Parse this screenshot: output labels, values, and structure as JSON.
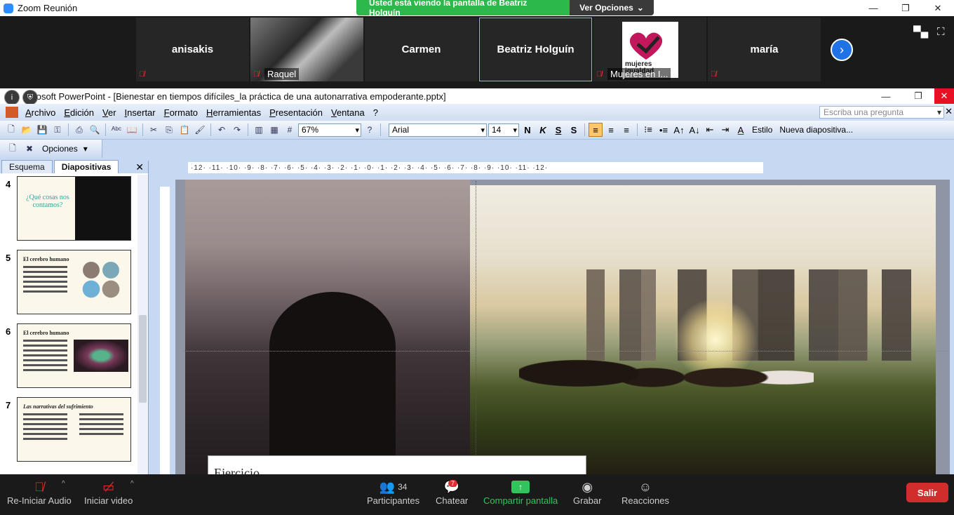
{
  "zoom": {
    "title": "Zoom Reunión",
    "share_banner": "Usted está viendo la pantalla de Beatriz Holguín",
    "view_options": "Ver Opciones",
    "participants": [
      {
        "name": "anisakis",
        "muted": true,
        "label": ""
      },
      {
        "name": "",
        "muted": true,
        "label": "Raquel"
      },
      {
        "name": "Carmen",
        "muted": false,
        "label": ""
      },
      {
        "name": "Beatriz Holguín",
        "muted": false,
        "label": ""
      },
      {
        "name": "",
        "muted": true,
        "label": "Mujeres en I..."
      },
      {
        "name": "maría",
        "muted": true,
        "label": ""
      }
    ],
    "logo_text": "mujeres igualdad",
    "toolbar": {
      "audio": "Re-Iniciar Audio",
      "video": "Iniciar video",
      "participants": "Participantes",
      "participants_count": "34",
      "chat": "Chatear",
      "chat_badge": "7",
      "share": "Compartir pantalla",
      "record": "Grabar",
      "reactions": "Reacciones",
      "leave": "Salir"
    }
  },
  "ppt": {
    "title": "icrosoft PowerPoint - [Bienestar en tiempos difíciles_la práctica de una autonarrativa empoderante.pptx]",
    "menu": [
      "Archivo",
      "Edición",
      "Ver",
      "Insertar",
      "Formato",
      "Herramientas",
      "Presentación",
      "Ventana",
      "?"
    ],
    "ask_placeholder": "Escriba una pregunta",
    "zoom_level": "67%",
    "font": "Arial",
    "font_size": "14",
    "style_label": "Estilo",
    "new_slide_label": "Nueva diapositiva...",
    "options_label": "Opciones",
    "tabs": [
      "Esquema",
      "Diapositivas"
    ],
    "slides": [
      {
        "num": "4",
        "title": "¿Qué cosas nos contamos?"
      },
      {
        "num": "5",
        "title": "El cerebro humano"
      },
      {
        "num": "6",
        "title": "El cerebro humano"
      },
      {
        "num": "7",
        "title": "Las narrativas del sufrimiento"
      }
    ],
    "ruler_top": "·12·  ·11·  ·10·  ·9·  ·8·  ·7·  ·6·  ·5·  ·4·  ·3·  ·2·  ·1·  ·0·  ·1·  ·2·  ·3·  ·4·  ·5·  ·6·  ·7·  ·8·  ·9·  ·10·  ·11·  ·12·",
    "slide_text": "Ejercicio"
  },
  "colors": {
    "zoom_dark": "#1a1a1a",
    "banner_green": "#2db84b",
    "close_red": "#e81123",
    "leave_red": "#d22d2d"
  }
}
